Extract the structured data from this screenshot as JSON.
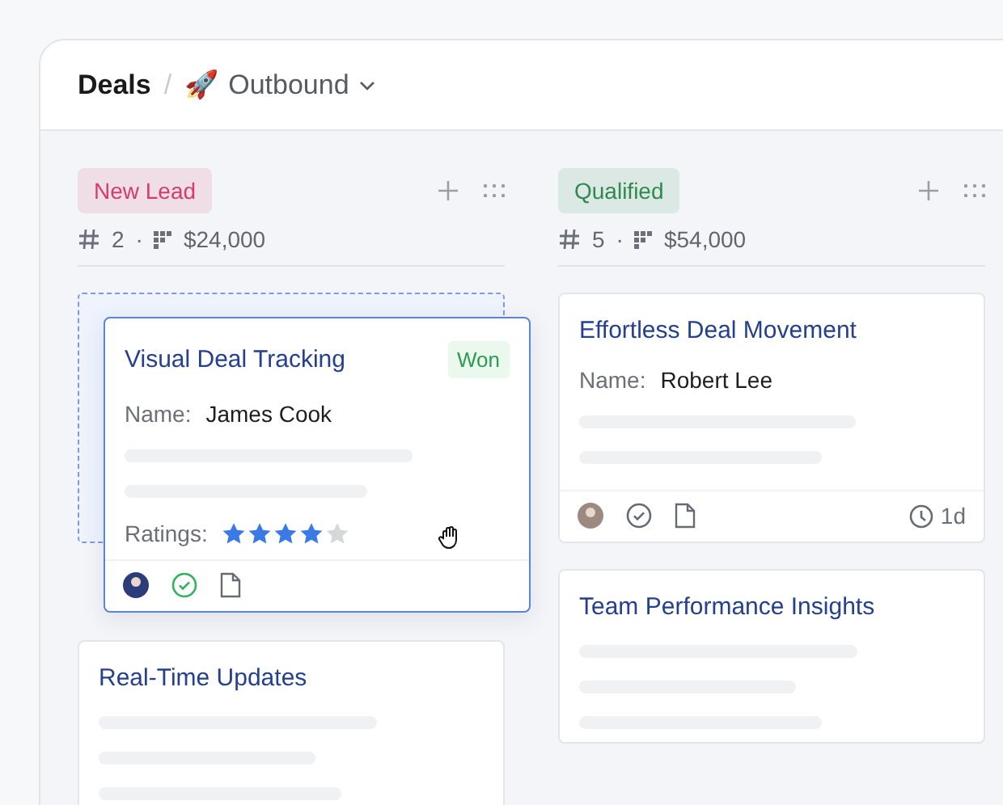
{
  "header": {
    "title": "Deals",
    "separator": "/",
    "view_icon": "🚀",
    "view": "Outbound"
  },
  "columns": [
    {
      "label": "New Lead",
      "color": "#d63a6e",
      "count": "2",
      "dot": "·",
      "amount": "$24,000",
      "cards": [
        {
          "kind": "dragging",
          "title": "Visual Deal Tracking",
          "status": "Won",
          "name_label": "Name:",
          "name": "James Cook",
          "ratings_label": "Ratings:",
          "stars": 4,
          "done": true
        },
        {
          "kind": "collapsed",
          "title": "Real-Time Updates"
        }
      ]
    },
    {
      "label": "Qualified",
      "color": "#2f8a4f",
      "count": "5",
      "dot": "·",
      "amount": "$54,000",
      "cards": [
        {
          "kind": "normal",
          "title": "Effortless Deal Movement",
          "name_label": "Name:",
          "name": "Robert Lee",
          "done": false,
          "age": "1d"
        },
        {
          "kind": "collapsed",
          "title": "Team Performance Insights"
        }
      ]
    }
  ]
}
